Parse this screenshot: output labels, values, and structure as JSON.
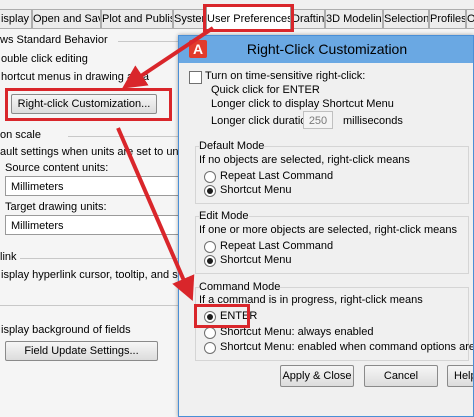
{
  "tabs": [
    {
      "label": "isplay"
    },
    {
      "label": "Open and Save"
    },
    {
      "label": "Plot and Publish"
    },
    {
      "label": "System"
    },
    {
      "label": "User Preferences"
    },
    {
      "label": "Drafting"
    },
    {
      "label": "3D Modeling"
    },
    {
      "label": "Selection"
    },
    {
      "label": "Profiles"
    },
    {
      "label": "On"
    }
  ],
  "options": {
    "windows_behavior": "ws Standard Behavior",
    "double_click": "ouble click editing",
    "shortcut_menus": "hortcut menus in drawing area",
    "rightclick_button": "Right-click Customization...",
    "insertion_scale": "on scale",
    "default_settings": "ault settings when units are set to unitless:",
    "source_units_label": "Source content units:",
    "source_units_value": "Millimeters",
    "target_units_label": "Target drawing units:",
    "target_units_value": "Millimeters",
    "hyperlink_header": "link",
    "hyperlink_cursor": "isplay hyperlink cursor, tooltip, and shortcut",
    "fields_bg": "isplay background of fields",
    "field_update_button": "Field Update Settings..."
  },
  "dialog": {
    "title": "Right-Click Customization",
    "app_icon_letter": "A",
    "time_sensitive_label": "Turn on time-sensitive right-click:",
    "quick_click": "Quick click for ENTER",
    "longer_click": "Longer click to display Shortcut Menu",
    "duration_label": "Longer click duration:",
    "duration_value": "250",
    "duration_unit": "milliseconds",
    "default_mode": {
      "title": "Default Mode",
      "desc": "If no objects are selected, right-click means",
      "options": [
        "Repeat Last Command",
        "Shortcut Menu"
      ],
      "selected": 1
    },
    "edit_mode": {
      "title": "Edit Mode",
      "desc": "If one or more objects are selected, right-click means",
      "options": [
        "Repeat Last Command",
        "Shortcut Menu"
      ],
      "selected": 1
    },
    "command_mode": {
      "title": "Command Mode",
      "desc": "If a command is in progress, right-click means",
      "options": [
        "ENTER",
        "Shortcut Menu: always enabled",
        "Shortcut Menu: enabled when command options are present"
      ],
      "selected": 0
    },
    "apply_close": "Apply & Close",
    "cancel": "Cancel",
    "help": "Help"
  },
  "colors": {
    "highlight": "#d9262b",
    "titlebar": "#6aa8e3",
    "app_icon": "#e23b2c"
  }
}
